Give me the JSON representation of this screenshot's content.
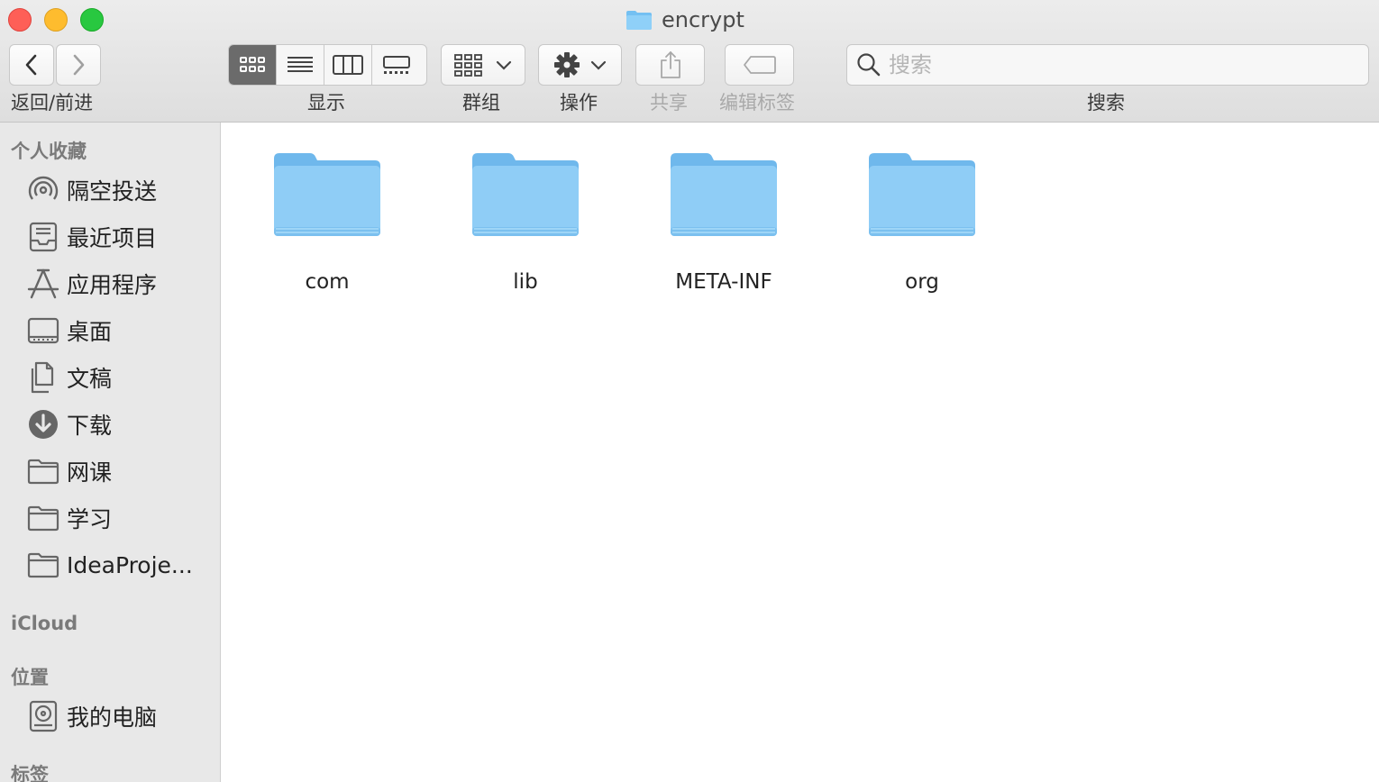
{
  "window": {
    "title": "encrypt"
  },
  "toolbar": {
    "nav_label": "返回/前进",
    "view_label": "显示",
    "group_label": "群组",
    "action_label": "操作",
    "share_label": "共享",
    "tags_label": "编辑标签",
    "search_label": "搜索",
    "search_placeholder": "搜索",
    "active_view": "icon"
  },
  "sidebar": {
    "favorites_header": "个人收藏",
    "favorites": [
      {
        "label": "隔空投送",
        "icon": "airdrop-icon"
      },
      {
        "label": "最近项目",
        "icon": "recents-icon"
      },
      {
        "label": "应用程序",
        "icon": "applications-icon"
      },
      {
        "label": "桌面",
        "icon": "desktop-icon"
      },
      {
        "label": "文稿",
        "icon": "documents-icon"
      },
      {
        "label": "下载",
        "icon": "downloads-icon"
      },
      {
        "label": "网课",
        "icon": "folder-icon"
      },
      {
        "label": "学习",
        "icon": "folder-icon"
      },
      {
        "label": "IdeaProje...",
        "icon": "folder-icon"
      }
    ],
    "icloud_header": "iCloud",
    "locations_header": "位置",
    "locations": [
      {
        "label": "我的电脑",
        "icon": "hard-disk-icon"
      }
    ],
    "tags_header": "标签"
  },
  "files": [
    {
      "name": "com"
    },
    {
      "name": "lib"
    },
    {
      "name": "META-INF"
    },
    {
      "name": "org"
    }
  ],
  "colors": {
    "folder": "#74c0f2",
    "folder_light": "#a9d9f8",
    "accent_red": "#fe5f57",
    "accent_yellow": "#febc2e",
    "accent_green": "#28c840"
  }
}
